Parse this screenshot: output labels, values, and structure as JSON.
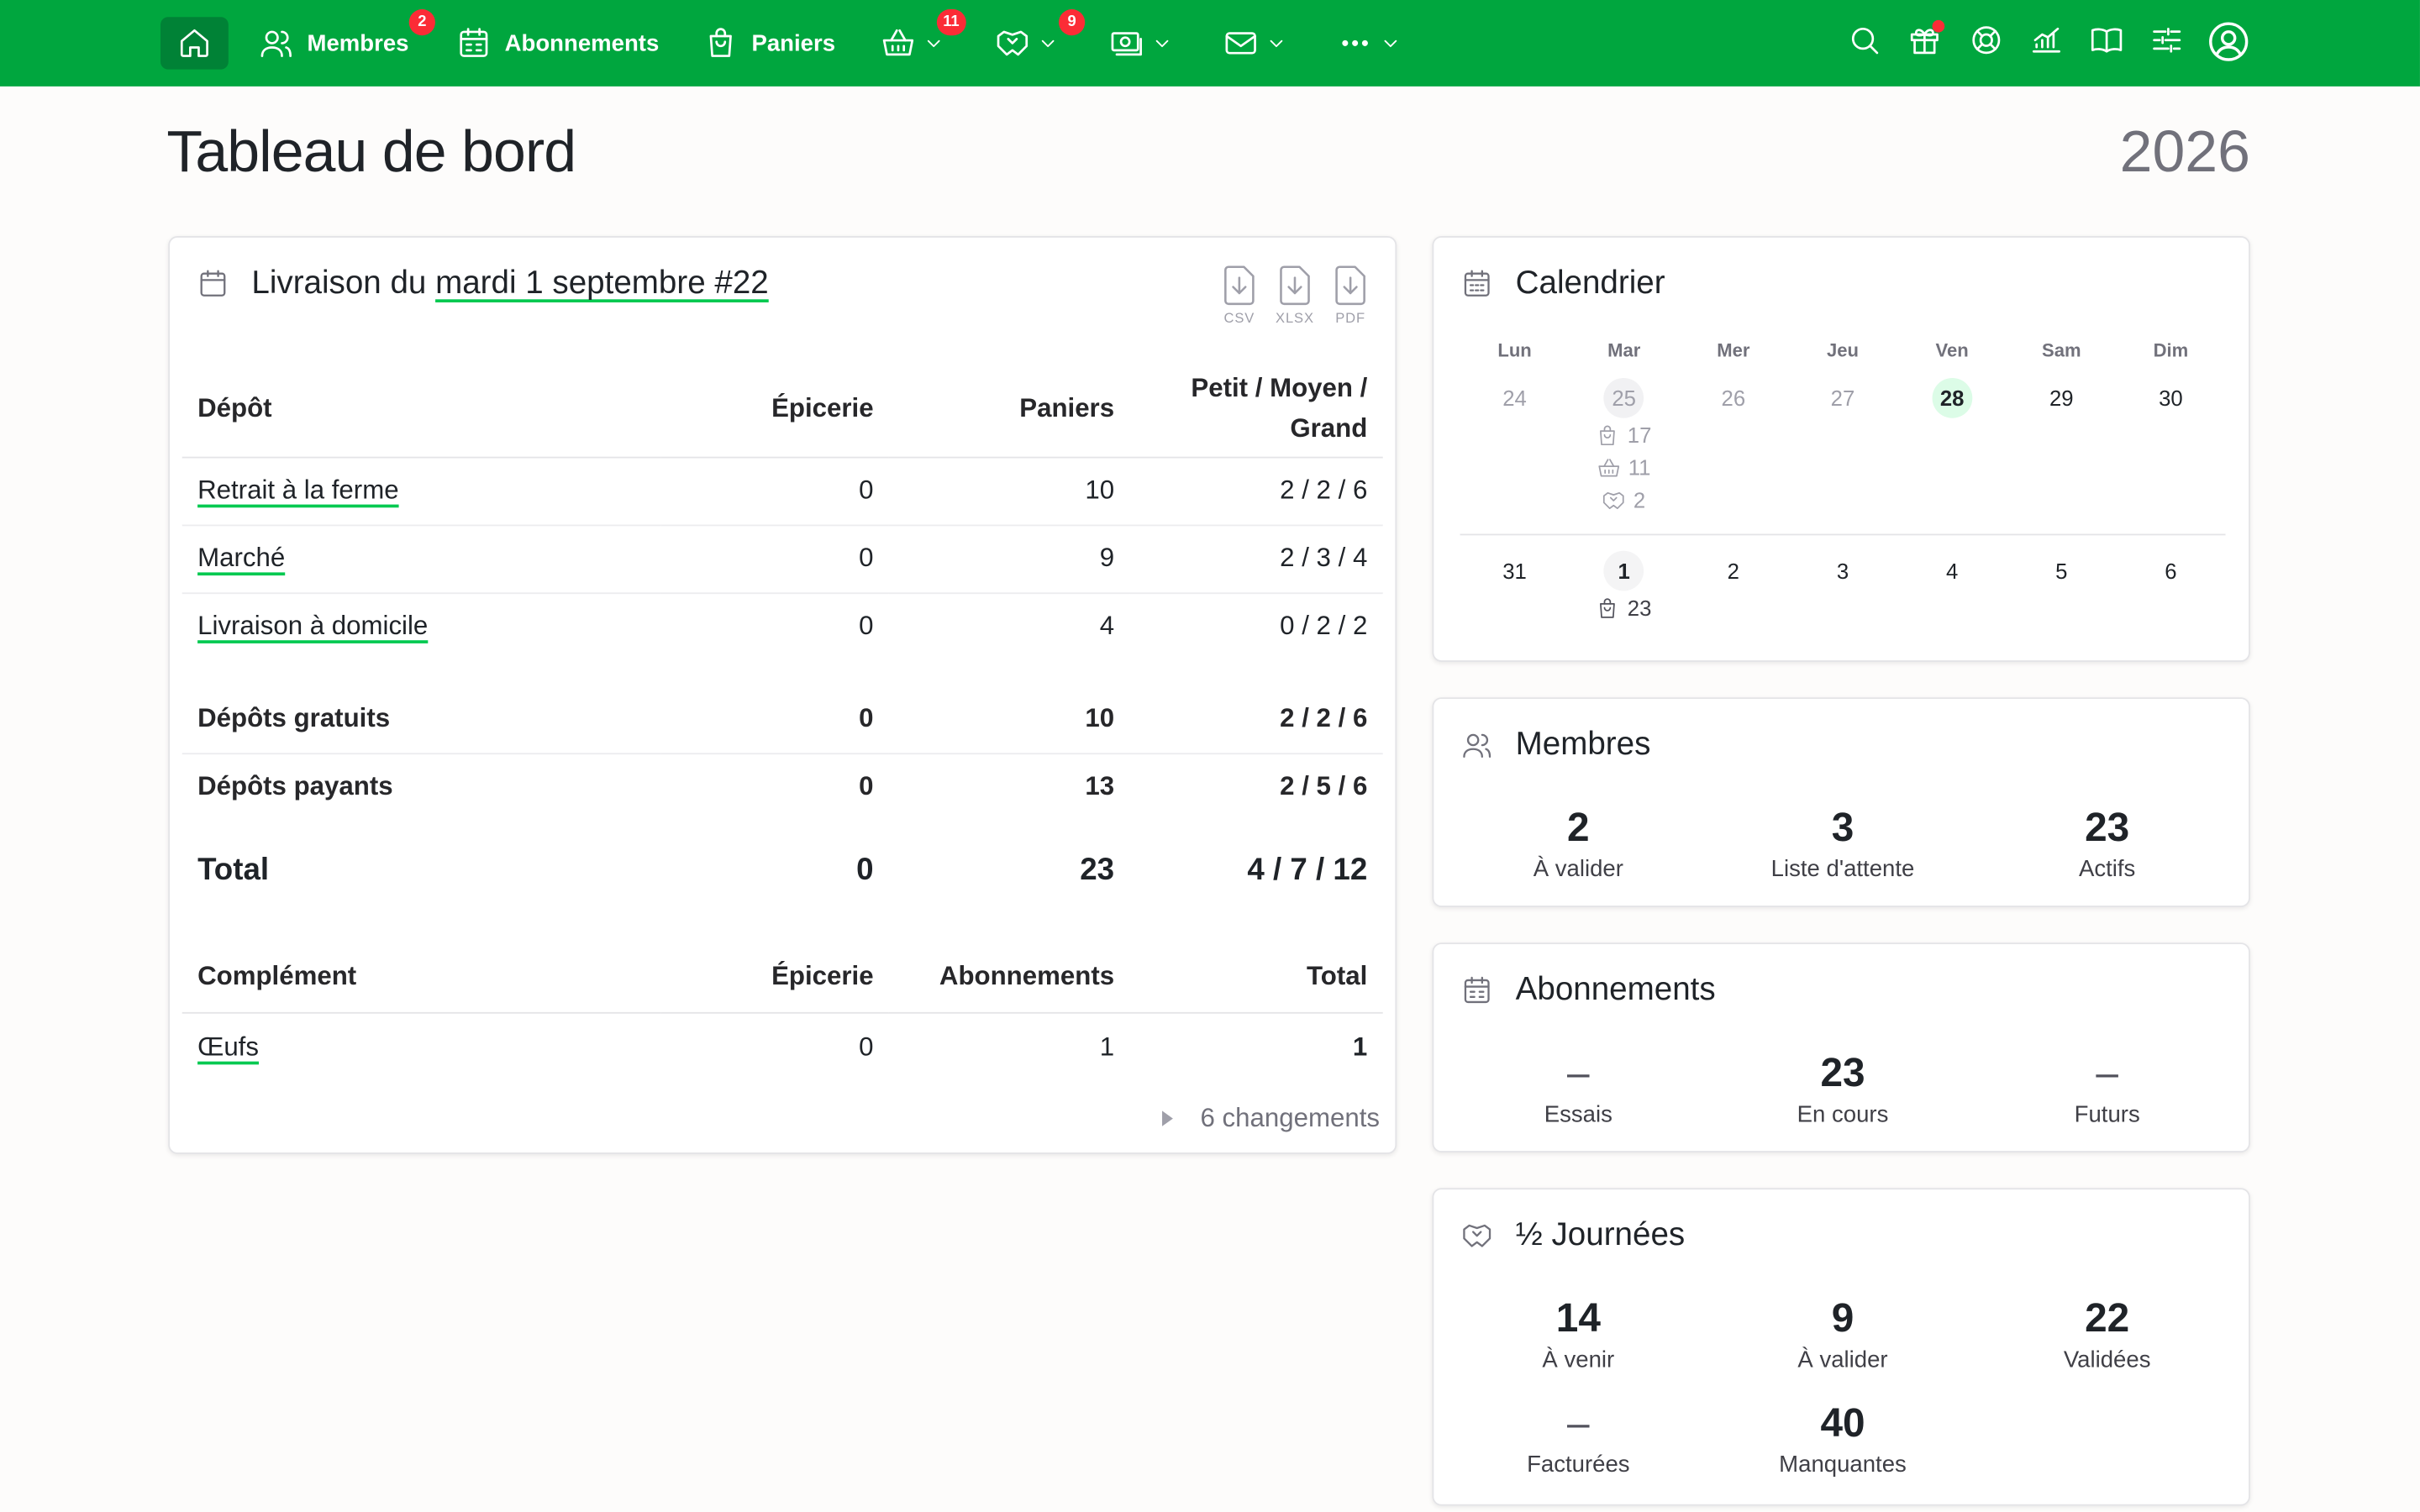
{
  "nav": {
    "members_label": "Membres",
    "members_badge": "2",
    "subscriptions_label": "Abonnements",
    "baskets_label": "Paniers",
    "shop_badge": "11",
    "activity_badge": "9"
  },
  "page": {
    "title": "Tableau de bord",
    "year": "2026"
  },
  "delivery": {
    "title_prefix": "Livraison du",
    "title_link": "mardi 1 septembre #22",
    "exports": [
      "CSV",
      "XLSX",
      "PDF"
    ],
    "headers": {
      "depot": "Dépôt",
      "grocery": "Épicerie",
      "baskets": "Paniers",
      "sizes_1": "Petit / Moyen /",
      "sizes_2": "Grand"
    },
    "rows": [
      {
        "name": "Retrait à la ferme",
        "grocery": "0",
        "baskets": "10",
        "sizes": "2 / 2 / 6"
      },
      {
        "name": "Marché",
        "grocery": "0",
        "baskets": "9",
        "sizes": "2 / 3 / 4"
      },
      {
        "name": "Livraison à domicile",
        "grocery": "0",
        "baskets": "4",
        "sizes": "0 / 2 / 2"
      }
    ],
    "free": {
      "name": "Dépôts gratuits",
      "grocery": "0",
      "baskets": "10",
      "sizes": "2 / 2 / 6"
    },
    "paid": {
      "name": "Dépôts payants",
      "grocery": "0",
      "baskets": "13",
      "sizes": "2 / 5 / 6"
    },
    "total": {
      "name": "Total",
      "grocery": "0",
      "baskets": "23",
      "sizes": "4 / 7 / 12"
    },
    "complement_headers": {
      "name": "Complément",
      "grocery": "Épicerie",
      "subscriptions": "Abonnements",
      "total": "Total"
    },
    "complements": [
      {
        "name": "Œufs",
        "grocery": "0",
        "subscriptions": "1",
        "total": "1"
      }
    ],
    "changes": "6 changements"
  },
  "calendar": {
    "title": "Calendrier",
    "weekdays": [
      "Lun",
      "Mar",
      "Mer",
      "Jeu",
      "Ven",
      "Sam",
      "Dim"
    ],
    "week1": [
      "24",
      "25",
      "26",
      "27",
      "28",
      "29",
      "30"
    ],
    "week1_tue_info": {
      "baskets": "17",
      "shop": "11",
      "activity": "2"
    },
    "week2": [
      "31",
      "1",
      "2",
      "3",
      "4",
      "5",
      "6"
    ],
    "week2_tue_info": {
      "baskets": "23"
    }
  },
  "members": {
    "title": "Membres",
    "stats": [
      {
        "value": "2",
        "label": "À valider"
      },
      {
        "value": "3",
        "label": "Liste d'attente"
      },
      {
        "value": "23",
        "label": "Actifs"
      }
    ]
  },
  "subscriptions": {
    "title": "Abonnements",
    "stats": [
      {
        "value": "–",
        "label": "Essais"
      },
      {
        "value": "23",
        "label": "En cours"
      },
      {
        "value": "–",
        "label": "Futurs"
      }
    ]
  },
  "halfdays": {
    "title": "½ Journées",
    "stats": [
      {
        "value": "14",
        "label": "À venir"
      },
      {
        "value": "9",
        "label": "À valider"
      },
      {
        "value": "22",
        "label": "Validées"
      },
      {
        "value": "–",
        "label": "Facturées"
      },
      {
        "value": "40",
        "label": "Manquantes"
      }
    ]
  },
  "colors": {
    "brand": "#00a63e",
    "brand_dark": "#008236",
    "badge": "#fb2c36",
    "link_underline": "#00c950"
  },
  "icons": [
    "home-icon",
    "users-icon",
    "calendar-icon",
    "basket-icon",
    "shop-basket-icon",
    "handshake-icon",
    "money-icon",
    "mail-icon",
    "more-icon",
    "search-icon",
    "gift-icon",
    "support-icon",
    "stats-icon",
    "book-icon",
    "settings-icon",
    "account-icon",
    "download-file-icon"
  ]
}
